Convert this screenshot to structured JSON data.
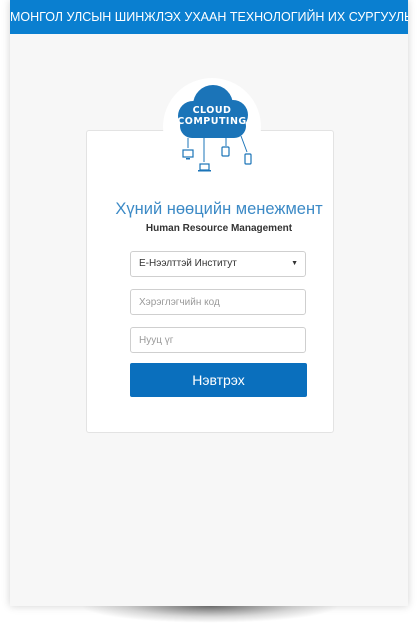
{
  "header": {
    "institution": "МОНГОЛ УЛСЫН ШИНЖЛЭХ УХААН ТЕХНОЛОГИЙН ИХ СУРГУУЛЬ"
  },
  "logo": {
    "line1": "CLOUD",
    "line2": "COMPUTING",
    "devices": [
      "monitor-icon",
      "tablet-icon",
      "laptop-icon",
      "phone-icon"
    ]
  },
  "login": {
    "title": "Хүний нөөцийн менежмент",
    "subtitle": "Human Resource Management",
    "institute_select": {
      "selected": "Е-Нээлттэй Институт"
    },
    "username_placeholder": "Хэрэглэгчийн код",
    "password_placeholder": "Нууц үг",
    "submit_label": "Нэвтрэх"
  },
  "colors": {
    "header_bg": "#0a7fd0",
    "accent": "#3c8ac6",
    "button_bg": "#0a6fbd",
    "cloud": "#1b74b8"
  }
}
